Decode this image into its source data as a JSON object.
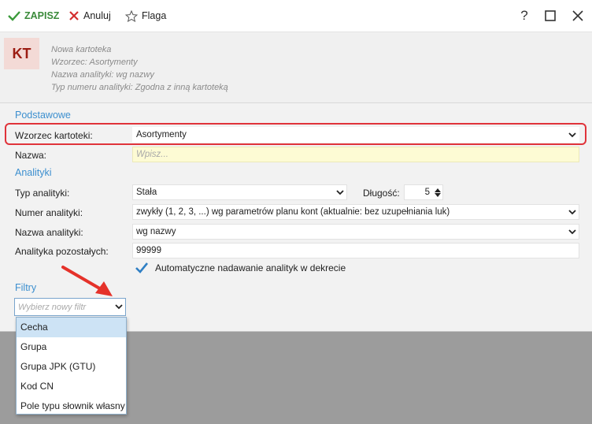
{
  "toolbar": {
    "save_label": "ZAPISZ",
    "cancel_label": "Anuluj",
    "flag_label": "Flaga",
    "help_label": "?"
  },
  "header": {
    "badge": "KT",
    "lines": [
      "Nowa kartoteka",
      "Wzorzec: Asortymenty",
      "Nazwa analityki: wg nazwy",
      "Typ numeru analityki: Zgodna z inną kartoteką"
    ]
  },
  "sections": {
    "basic": "Podstawowe",
    "analytics": "Analityki",
    "filters": "Filtry"
  },
  "form": {
    "template_label": "Wzorzec kartoteki:",
    "template_value": "Asortymenty",
    "name_label": "Nazwa:",
    "name_placeholder": "Wpisz...",
    "analytics_type_label": "Typ analityki:",
    "analytics_type_value": "Stała",
    "length_label": "Długość:",
    "length_value": "5",
    "analytics_number_label": "Numer analityki:",
    "analytics_number_value": "zwykły (1, 2, 3, ...) wg parametrów planu kont (aktualnie: bez uzupełniania luk)",
    "analytics_name_label": "Nazwa analityki:",
    "analytics_name_value": "wg nazwy",
    "analytics_rest_label": "Analityka pozostałych:",
    "analytics_rest_value": "99999",
    "auto_label": "Automatyczne nadawanie analityk w dekrecie",
    "auto_checked": true
  },
  "filter": {
    "placeholder": "Wybierz nowy filtr",
    "options": [
      "Cecha",
      "Grupa",
      "Grupa JPK (GTU)",
      "Kod CN",
      "Pole typu słownik własny"
    ],
    "selected": "Cecha"
  },
  "colors": {
    "accent": "#3c8fcf",
    "highlight": "#e0333a",
    "badge_bg": "#f3dad6",
    "badge_fg": "#9b1c12",
    "required_bg": "#fdfbd4"
  }
}
